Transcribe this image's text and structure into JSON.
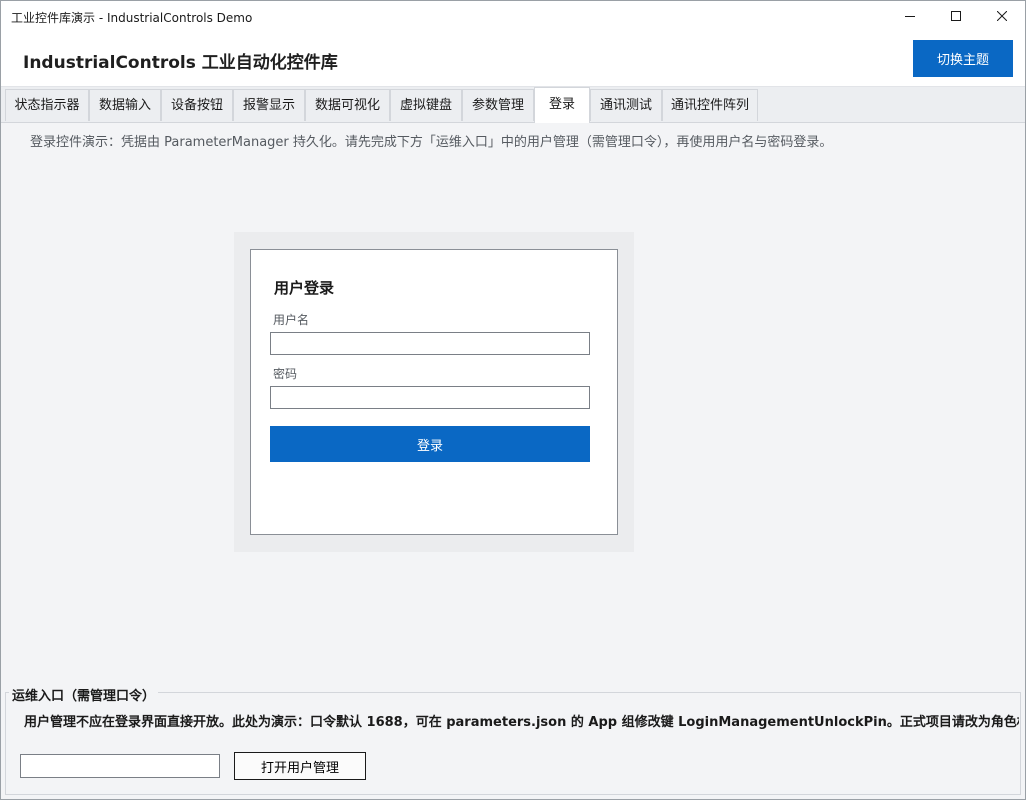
{
  "window": {
    "title": "工业控件库演示 - IndustrialControls Demo",
    "controls": {
      "minimize": "minimize-icon",
      "maximize": "maximize-icon",
      "close": "close-icon"
    }
  },
  "header": {
    "title": "IndustrialControls 工业自动化控件库",
    "theme_button": "切换主题"
  },
  "tabs": [
    {
      "label": "状态指示器"
    },
    {
      "label": "数据输入"
    },
    {
      "label": "设备按钮"
    },
    {
      "label": "报警显示"
    },
    {
      "label": "数据可视化"
    },
    {
      "label": "虚拟键盘"
    },
    {
      "label": "参数管理"
    },
    {
      "label": "登录",
      "active": true
    },
    {
      "label": "通讯测试"
    },
    {
      "label": "通讯控件阵列"
    }
  ],
  "login_page": {
    "description": "登录控件演示：凭据由 ParameterManager 持久化。请先完成下方「运维入口」中的用户管理（需管理口令），再使用用户名与密码登录。",
    "card": {
      "title": "用户登录",
      "username_label": "用户名",
      "username_value": "",
      "password_label": "密码",
      "password_value": "",
      "login_button": "登录"
    }
  },
  "maintenance": {
    "legend": "运维入口（需管理口令）",
    "notice": "用户管理不应在登录界面直接开放。此处为演示：口令默认 1688，可在 parameters.json 的 App 组修改键 LoginManagementUnlockPin。正式项目请改为角色权",
    "pin_value": "",
    "open_button": "打开用户管理"
  },
  "colors": {
    "accent": "#0a68c4",
    "background": "#f3f4f6",
    "card": "#ffffff"
  }
}
